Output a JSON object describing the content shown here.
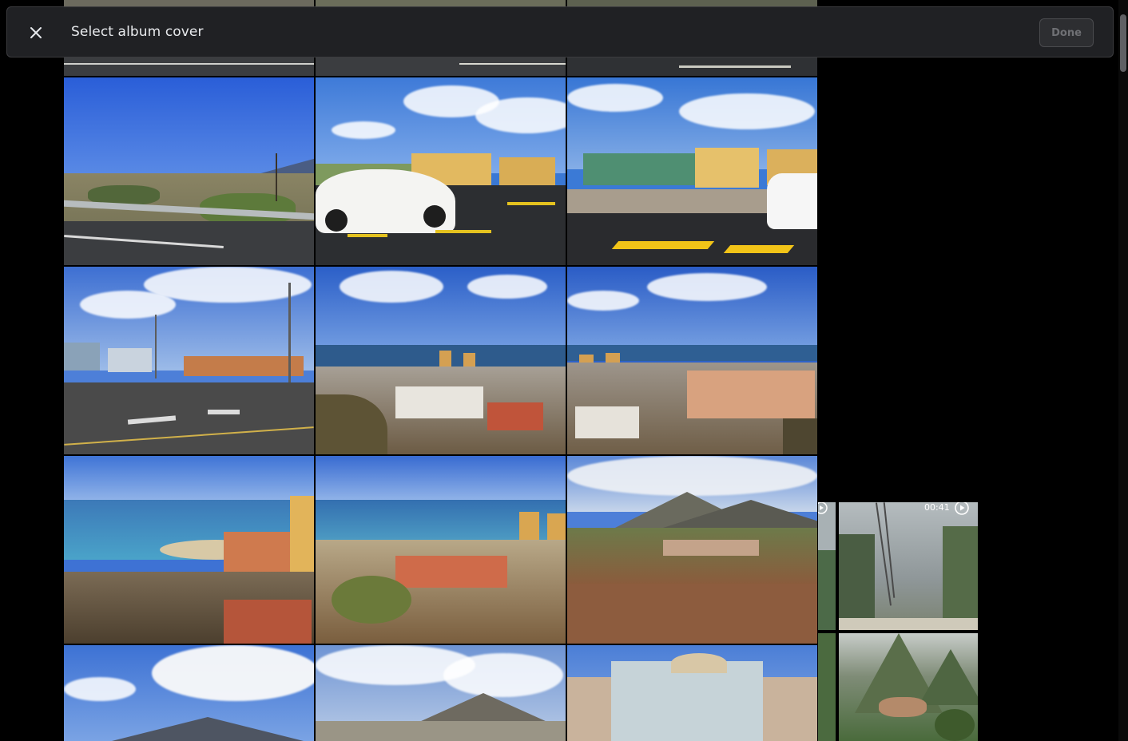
{
  "header": {
    "title": "Select album cover",
    "done_label": "Done",
    "close_icon": "close-icon"
  },
  "videos": [
    {
      "duration": "00:41",
      "icon": "play-circle-icon"
    }
  ],
  "colors": {
    "background": "#000000",
    "header_bg": "#202124",
    "title_text": "#e8eaed",
    "done_disabled_text": "#6f7074"
  }
}
